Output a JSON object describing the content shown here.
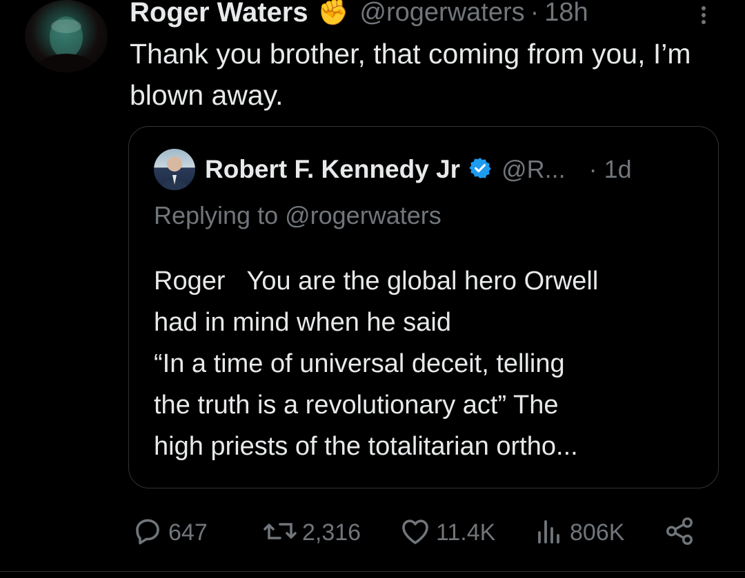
{
  "tweet": {
    "author_name": "Roger Waters",
    "author_badge": "✊",
    "handle": "@rogerwaters",
    "separator": "·",
    "time": "18h",
    "text": "Thank you brother, that coming from you, I’m blown away."
  },
  "quote": {
    "author_name": "Robert F. Kennedy Jr",
    "handle": "@R...",
    "separator": "·",
    "time": "1d",
    "replying_to": "Replying to @rogerwaters",
    "lines": [
      "Roger   You are the global hero Orwell",
      "had in mind when he said",
      "“In a time of universal deceit, telling",
      "the truth is a revolutionary act” The",
      "high priests of the totalitarian ortho..."
    ]
  },
  "actions": {
    "replies": "647",
    "reposts": "2,316",
    "likes": "11.4K",
    "views": "806K"
  },
  "colors": {
    "background": "#000000",
    "text": "#e7e9ea",
    "muted": "#71767b",
    "border": "#2f3336",
    "verified": "#1d9bf0",
    "badge": "#f5b91e"
  },
  "icons": [
    "more-icon",
    "verified-icon",
    "reply-icon",
    "repost-icon",
    "like-icon",
    "views-icon",
    "share-icon"
  ]
}
